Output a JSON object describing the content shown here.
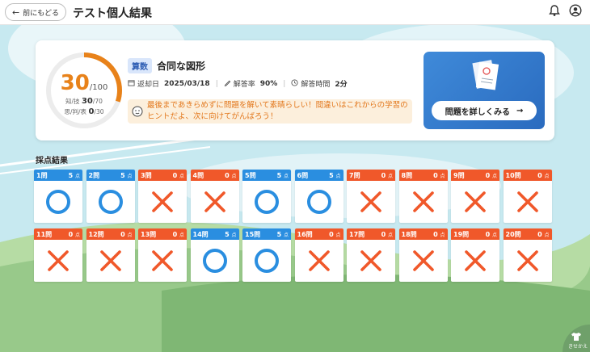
{
  "header": {
    "back_label": "前にもどる",
    "title": "テスト個人結果",
    "icons": [
      "bell-icon",
      "account-icon"
    ]
  },
  "summary": {
    "score": "30",
    "score_max": "/100",
    "knowledge_label": "知/技",
    "knowledge_score": "30",
    "knowledge_max": "/70",
    "thinking_label": "思/判/表",
    "thinking_score": "0",
    "thinking_max": "/30",
    "progress_fraction": 0.3,
    "subject": "算数",
    "unit_title": "合同な図形",
    "returned_date_label": "返却日",
    "returned_date": "2025/03/18",
    "accuracy_label": "解答率",
    "accuracy": "90%",
    "time_label": "解答時間",
    "time": "2分",
    "message": "最後まであきらめずに問題を解いて素晴らしい！間違いはこれからの学習のヒントだよ、次に向けてがんばろう！",
    "detail_button": "問題を詳しくみる"
  },
  "section_label": "採点結果",
  "questions": [
    {
      "label": "1問",
      "points": "5",
      "unit": "点",
      "result": "correct"
    },
    {
      "label": "2問",
      "points": "5",
      "unit": "点",
      "result": "correct"
    },
    {
      "label": "3問",
      "points": "0",
      "unit": "点",
      "result": "wrong"
    },
    {
      "label": "4問",
      "points": "0",
      "unit": "点",
      "result": "wrong"
    },
    {
      "label": "5問",
      "points": "5",
      "unit": "点",
      "result": "correct"
    },
    {
      "label": "6問",
      "points": "5",
      "unit": "点",
      "result": "correct"
    },
    {
      "label": "7問",
      "points": "0",
      "unit": "点",
      "result": "wrong"
    },
    {
      "label": "8問",
      "points": "0",
      "unit": "点",
      "result": "wrong"
    },
    {
      "label": "9問",
      "points": "0",
      "unit": "点",
      "result": "wrong"
    },
    {
      "label": "10問",
      "points": "0",
      "unit": "点",
      "result": "wrong"
    },
    {
      "label": "11問",
      "points": "0",
      "unit": "点",
      "result": "wrong"
    },
    {
      "label": "12問",
      "points": "0",
      "unit": "点",
      "result": "wrong"
    },
    {
      "label": "13問",
      "points": "0",
      "unit": "点",
      "result": "wrong"
    },
    {
      "label": "14問",
      "points": "5",
      "unit": "点",
      "result": "correct"
    },
    {
      "label": "15問",
      "points": "5",
      "unit": "点",
      "result": "correct"
    },
    {
      "label": "16問",
      "points": "0",
      "unit": "点",
      "result": "wrong"
    },
    {
      "label": "17問",
      "points": "0",
      "unit": "点",
      "result": "wrong"
    },
    {
      "label": "18問",
      "points": "0",
      "unit": "点",
      "result": "wrong"
    },
    {
      "label": "19問",
      "points": "0",
      "unit": "点",
      "result": "wrong"
    },
    {
      "label": "20問",
      "points": "0",
      "unit": "点",
      "result": "wrong"
    }
  ],
  "dressup_label": "きせかえ",
  "colors": {
    "correct": "#2a8ee0",
    "wrong": "#f0582a",
    "accent": "#e8821a"
  }
}
